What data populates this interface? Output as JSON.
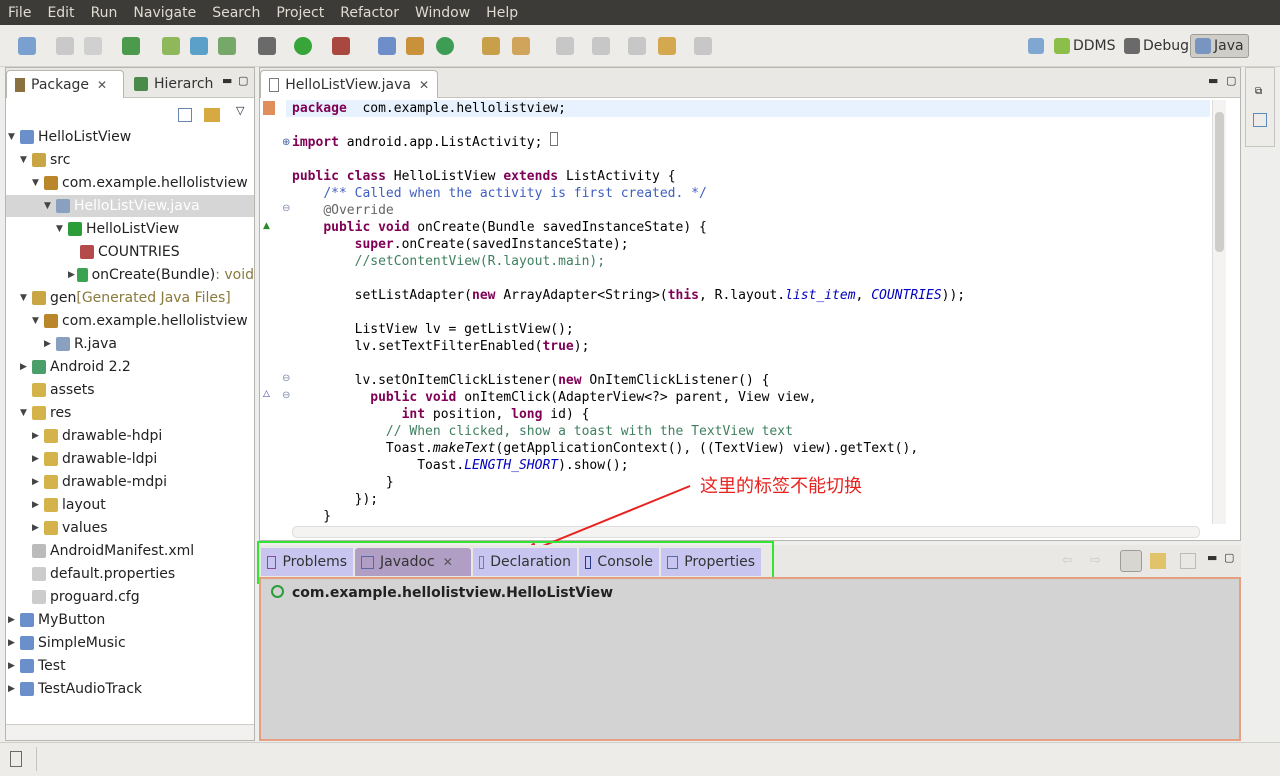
{
  "menu": [
    "File",
    "Edit",
    "Run",
    "Navigate",
    "Search",
    "Project",
    "Refactor",
    "Window",
    "Help"
  ],
  "perspectives": {
    "ddms": "DDMS",
    "debug": "Debug",
    "java": "Java"
  },
  "left_panel": {
    "tab_package": "Package",
    "tab_hierarchy": "Hierarch",
    "tree": [
      {
        "label": "HelloListView",
        "indent": 0,
        "tw": "▼",
        "icon": "project-icon",
        "color": "#6a8fcb"
      },
      {
        "label": "src",
        "indent": 1,
        "tw": "▼",
        "icon": "source-folder-icon",
        "color": "#c9a643"
      },
      {
        "label": "com.example.hellolistview",
        "indent": 2,
        "tw": "▼",
        "icon": "package-icon",
        "color": "#b9862b"
      },
      {
        "label": "HelloListView.java",
        "indent": 3,
        "tw": "▼",
        "icon": "java-file-icon",
        "color": "#8aa0c0",
        "sel": true
      },
      {
        "label": "HelloListView",
        "indent": 4,
        "tw": "▼",
        "icon": "class-icon",
        "color": "#2b9e3a"
      },
      {
        "label": "COUNTRIES",
        "indent": 5,
        "tw": "",
        "icon": "field-icon",
        "color": "#b54a4a"
      },
      {
        "label": "onCreate(Bundle)",
        "suffix": " : void",
        "indent": 5,
        "tw": "▶",
        "icon": "method-icon",
        "color": "#3aa34f"
      },
      {
        "label": "gen",
        "suffix": " [Generated Java Files]",
        "indent": 1,
        "tw": "▼",
        "icon": "source-folder-icon",
        "color": "#c9a643"
      },
      {
        "label": "com.example.hellolistview",
        "indent": 2,
        "tw": "▼",
        "icon": "package-icon",
        "color": "#b9862b"
      },
      {
        "label": "R.java",
        "indent": 3,
        "tw": "▶",
        "icon": "java-file-icon",
        "color": "#8aa0c0"
      },
      {
        "label": "Android 2.2",
        "indent": 1,
        "tw": "▶",
        "icon": "library-icon",
        "color": "#4a9e6a"
      },
      {
        "label": "assets",
        "indent": 1,
        "tw": "",
        "icon": "folder-icon",
        "color": "#d4b44a"
      },
      {
        "label": "res",
        "indent": 1,
        "tw": "▼",
        "icon": "folder-icon",
        "color": "#d4b44a"
      },
      {
        "label": "drawable-hdpi",
        "indent": 2,
        "tw": "▶",
        "icon": "folder-icon",
        "color": "#d4b44a"
      },
      {
        "label": "drawable-ldpi",
        "indent": 2,
        "tw": "▶",
        "icon": "folder-icon",
        "color": "#d4b44a"
      },
      {
        "label": "drawable-mdpi",
        "indent": 2,
        "tw": "▶",
        "icon": "folder-icon",
        "color": "#d4b44a"
      },
      {
        "label": "layout",
        "indent": 2,
        "tw": "▶",
        "icon": "folder-icon",
        "color": "#d4b44a"
      },
      {
        "label": "values",
        "indent": 2,
        "tw": "▶",
        "icon": "folder-icon",
        "color": "#d4b44a"
      },
      {
        "label": "AndroidManifest.xml",
        "indent": 1,
        "tw": "",
        "icon": "xml-file-icon",
        "color": "#bbbbbb"
      },
      {
        "label": "default.properties",
        "indent": 1,
        "tw": "",
        "icon": "file-icon",
        "color": "#cccccc"
      },
      {
        "label": "proguard.cfg",
        "indent": 1,
        "tw": "",
        "icon": "file-icon",
        "color": "#cccccc"
      },
      {
        "label": "MyButton",
        "indent": 0,
        "tw": "▶",
        "icon": "project-icon",
        "color": "#6a8fcb"
      },
      {
        "label": "SimpleMusic",
        "indent": 0,
        "tw": "▶",
        "icon": "project-icon",
        "color": "#6a8fcb"
      },
      {
        "label": "Test",
        "indent": 0,
        "tw": "▶",
        "icon": "project-icon",
        "color": "#6a8fcb"
      },
      {
        "label": "TestAudioTrack",
        "indent": 0,
        "tw": "▶",
        "icon": "project-icon",
        "color": "#6a8fcb"
      }
    ]
  },
  "editor": {
    "tab": "HelloListView.java",
    "lines": [
      [
        [
          "kw",
          "package"
        ],
        [
          "",
          "  com.example.hellolistview;"
        ]
      ],
      [],
      [
        [
          "kw",
          "import"
        ],
        [
          "",
          " android.app.ListActivity;"
        ]
      ],
      [],
      [
        [
          "kw",
          "public class"
        ],
        [
          "",
          " HelloListView "
        ],
        [
          "kw",
          "extends"
        ],
        [
          "",
          " ListActivity {"
        ]
      ],
      [
        [
          "",
          "    "
        ],
        [
          "cm",
          "/** Called when the activity is first created. */"
        ]
      ],
      [
        [
          "",
          "    "
        ],
        [
          "an",
          "@Override"
        ]
      ],
      [
        [
          "",
          "    "
        ],
        [
          "kw",
          "public void"
        ],
        [
          "",
          " onCreate(Bundle savedInstanceState) {"
        ]
      ],
      [
        [
          "",
          "        "
        ],
        [
          "kw",
          "super"
        ],
        [
          "",
          ".onCreate(savedInstanceState);"
        ]
      ],
      [
        [
          "",
          "        "
        ],
        [
          "gc",
          "//setContentView(R.layout.main);"
        ]
      ],
      [],
      [
        [
          "",
          "        setListAdapter("
        ],
        [
          "kw",
          "new"
        ],
        [
          "",
          " ArrayAdapter<String>("
        ],
        [
          "kw",
          "this"
        ],
        [
          "",
          ", R.layout."
        ],
        [
          "it",
          "list_item"
        ],
        [
          "",
          ", "
        ],
        [
          "it",
          "COUNTRIES"
        ],
        [
          "",
          "));"
        ]
      ],
      [],
      [
        [
          "",
          "        ListView lv = getListView();"
        ]
      ],
      [
        [
          "",
          "        lv.setTextFilterEnabled("
        ],
        [
          "kw",
          "true"
        ],
        [
          "",
          ");"
        ]
      ],
      [],
      [
        [
          "",
          "        lv.setOnItemClickListener("
        ],
        [
          "kw",
          "new"
        ],
        [
          "",
          " OnItemClickListener() {"
        ]
      ],
      [
        [
          "",
          "          "
        ],
        [
          "kw",
          "public void"
        ],
        [
          "",
          " onItemClick(AdapterView<?> parent, View view,"
        ]
      ],
      [
        [
          "",
          "              "
        ],
        [
          "kw",
          "int"
        ],
        [
          "",
          " position, "
        ],
        [
          "kw",
          "long"
        ],
        [
          "",
          " id) {"
        ]
      ],
      [
        [
          "",
          "            "
        ],
        [
          "gc",
          "// When clicked, show a toast with the TextView text"
        ]
      ],
      [
        [
          "",
          "            Toast."
        ],
        [
          "it2",
          "makeText"
        ],
        [
          "",
          "(getApplicationContext(), ((TextView) view).getText(),"
        ]
      ],
      [
        [
          "",
          "                Toast."
        ],
        [
          "it",
          "LENGTH_SHORT"
        ],
        [
          "",
          ").show();"
        ]
      ],
      [
        [
          "",
          "            }"
        ]
      ],
      [
        [
          "",
          "        });"
        ]
      ],
      [
        [
          "",
          "    }"
        ]
      ]
    ]
  },
  "annotation": "这里的标签不能切换",
  "bottom_panel": {
    "tabs": [
      {
        "label": "Problems",
        "icon": "problems-icon"
      },
      {
        "label": "Javadoc",
        "icon": "javadoc-icon",
        "active": true
      },
      {
        "label": "Declaration",
        "icon": "declaration-icon"
      },
      {
        "label": "Console",
        "icon": "console-icon"
      },
      {
        "label": "Properties",
        "icon": "properties-icon"
      }
    ],
    "javadoc_title": "com.example.hellolistview.HelloListView"
  }
}
